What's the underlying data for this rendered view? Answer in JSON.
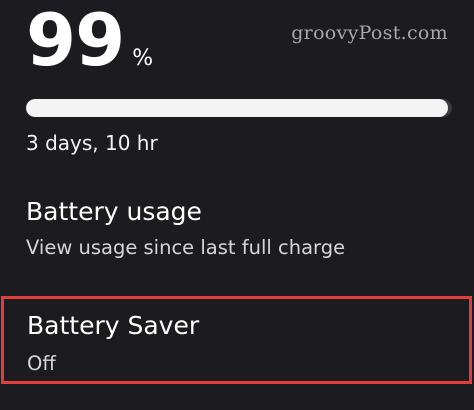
{
  "watermark": "groovyPost.com",
  "battery": {
    "level": "99",
    "unit": "%",
    "level_fraction": 0.99,
    "remaining": "3 days, 10 hr"
  },
  "preferences": {
    "usage": {
      "title": "Battery usage",
      "summary": "View usage since last full charge"
    },
    "saver": {
      "title": "Battery Saver",
      "summary": "Off",
      "highlight_color": "#e53b3b"
    }
  }
}
